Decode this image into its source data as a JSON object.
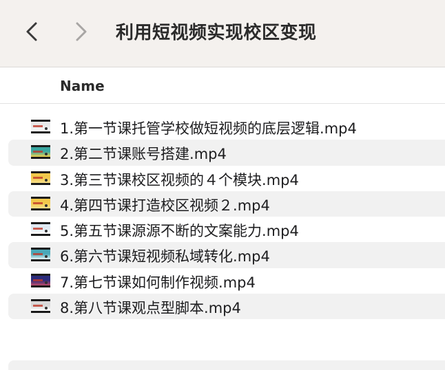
{
  "window": {
    "title": "利用短视频实现校区变现"
  },
  "toolbar": {
    "back_icon": "chevron-left-icon",
    "forward_icon": "chevron-right-icon"
  },
  "columns": {
    "name": "Name"
  },
  "files": [
    {
      "name": "1.第一节课托管学校做短视频的底层逻辑.mp4",
      "thumb_colors": [
        "#e8e8e8",
        "#ffffff"
      ]
    },
    {
      "name": "2.第二节课账号搭建.mp4",
      "thumb_colors": [
        "#3aa6a0",
        "#f2d04a"
      ]
    },
    {
      "name": "3.第三节课校区视频的４个模块.mp4",
      "thumb_colors": [
        "#f2c84b",
        "#f7e08a"
      ]
    },
    {
      "name": "4.第四节课打造校区视频２.mp4",
      "thumb_colors": [
        "#f2c84b",
        "#f7e08a"
      ]
    },
    {
      "name": "5.第五节课源源不断的文案能力.mp4",
      "thumb_colors": [
        "#dfe9f2",
        "#ffffff"
      ]
    },
    {
      "name": "6.第六节课短视频私域转化.mp4",
      "thumb_colors": [
        "#4aa8b8",
        "#e8f4f6"
      ]
    },
    {
      "name": "7.第七节课如何制作视频.mp4",
      "thumb_colors": [
        "#2a2a7a",
        "#c04a6a"
      ]
    },
    {
      "name": "8.第八节课观点型脚本.mp4",
      "thumb_colors": [
        "#d8d8d8",
        "#ffffff"
      ]
    }
  ]
}
